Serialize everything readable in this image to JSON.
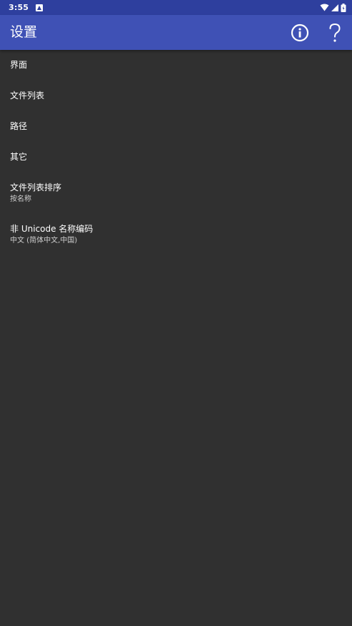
{
  "status_bar": {
    "time": "3:55",
    "icons": [
      "notification-a-icon",
      "wifi-icon",
      "signal-icon",
      "battery-icon"
    ]
  },
  "app_bar": {
    "title": "设置",
    "actions": [
      {
        "name": "info-icon",
        "label": "info"
      },
      {
        "name": "help-icon",
        "glyph": "?"
      }
    ]
  },
  "preferences": [
    {
      "title": "界面"
    },
    {
      "title": "文件列表"
    },
    {
      "title": "路径"
    },
    {
      "title": "其它"
    },
    {
      "title": "文件列表排序",
      "summary": "按名称"
    },
    {
      "title": "非 Unicode 名称编码",
      "summary": "中文 (简体中文,中国)"
    }
  ],
  "colors": {
    "status_bar": "#2e3f9e",
    "app_bar": "#3f51b5",
    "background": "#303030",
    "text_primary": "#ffffff",
    "text_secondary": "#cfcfcf"
  }
}
